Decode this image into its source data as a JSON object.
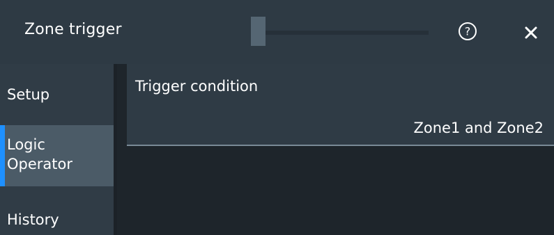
{
  "dialog": {
    "title": "Zone trigger"
  },
  "sidebar": {
    "items": [
      {
        "label": "Setup"
      },
      {
        "label": "Logic\nOperator"
      },
      {
        "label": "History"
      }
    ]
  },
  "main": {
    "trigger_condition": {
      "label": "Trigger condition",
      "value": "Zone1 and Zone2"
    }
  },
  "icons": {
    "help": "help-icon",
    "close": "close-icon"
  },
  "colors": {
    "accent": "#1e90ff"
  }
}
